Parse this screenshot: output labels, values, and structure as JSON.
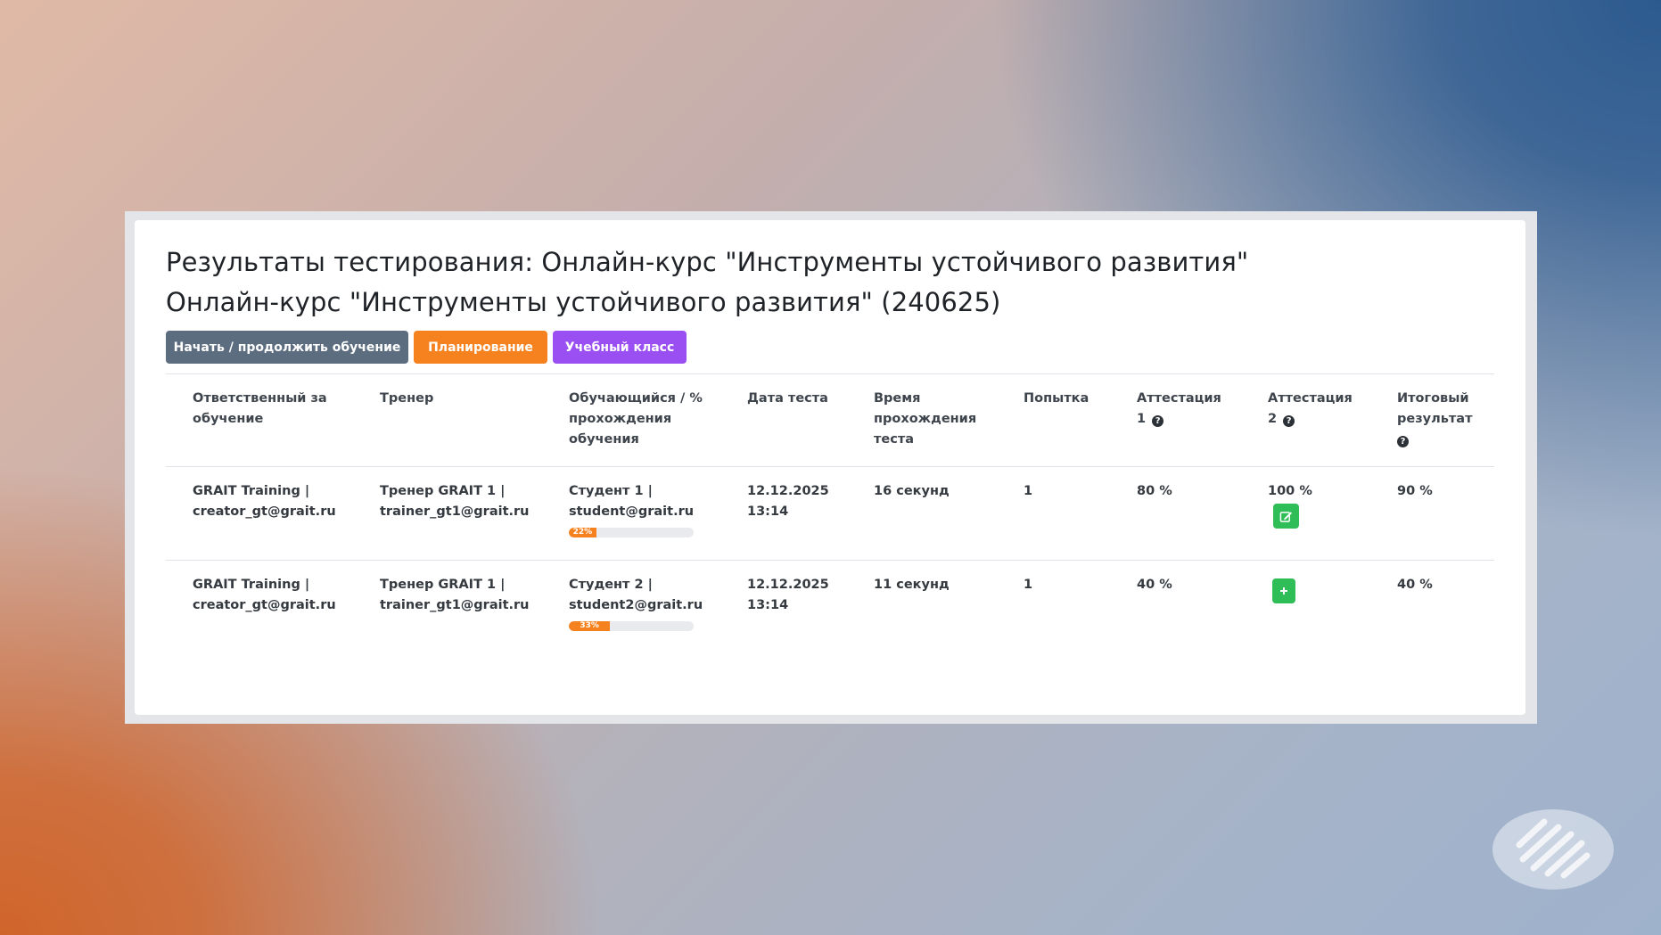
{
  "page": {
    "title_line1": "Результаты тестирования: Онлайн-курс \"Инструменты устойчивого развития\"",
    "title_line2": "Онлайн-курс \"Инструменты устойчивого развития\" (240625)"
  },
  "toolbar": {
    "start_label": "Начать / продолжить обучение",
    "planning_label": "Планирование",
    "classroom_label": "Учебный класс"
  },
  "table": {
    "headers": [
      {
        "lines": [
          "Ответственный за",
          "обучение"
        ]
      },
      {
        "lines": [
          "Тренер"
        ]
      },
      {
        "lines": [
          "Обучающийся / %",
          "прохождения",
          "обучения"
        ]
      },
      {
        "lines": [
          "Дата теста"
        ]
      },
      {
        "lines": [
          "Время",
          "прохождения",
          "теста"
        ]
      },
      {
        "lines": [
          "Попытка"
        ]
      },
      {
        "lines": [
          "Аттестация",
          "1"
        ]
      },
      {
        "lines": [
          "Аттестация",
          "2"
        ]
      },
      {
        "lines": [
          "Итоговый",
          "результат"
        ]
      }
    ],
    "rows": [
      {
        "responsible": [
          "GRAIT Training |",
          "creator_gt@grait.ru"
        ],
        "trainer": [
          "Тренер GRAIT 1 |",
          "trainer_gt1@grait.ru"
        ],
        "student": [
          "Студент 1 |",
          "student@grait.ru"
        ],
        "progress": 22,
        "progress_label": "22%",
        "date": [
          "12.12.2025",
          "13:14"
        ],
        "duration": "16 секунд",
        "attempt": "1",
        "att1": "80 %",
        "att2": "100 %",
        "att2_action_icon": "edit-icon",
        "final": "90 %"
      },
      {
        "responsible": [
          "GRAIT Training |",
          "creator_gt@grait.ru"
        ],
        "trainer": [
          "Тренер GRAIT 1 |",
          "trainer_gt1@grait.ru"
        ],
        "student": [
          "Студент 2 |",
          "student2@grait.ru"
        ],
        "progress": 33,
        "progress_label": "33%",
        "date": [
          "12.12.2025",
          "13:14"
        ],
        "duration": "11 секунд",
        "attempt": "1",
        "att1": "40 %",
        "att2": "",
        "att2_action_icon": "plus-icon",
        "final": "40 %"
      }
    ]
  },
  "colors": {
    "button_gray": "#5d6d80",
    "button_orange": "#f6821f",
    "button_purple": "#9a4ff2",
    "action_green": "#2fbd58",
    "progress_orange": "#f6821f"
  },
  "icons": {
    "help": "question-circle-icon",
    "brand_logo": "stripes-logo-icon"
  }
}
